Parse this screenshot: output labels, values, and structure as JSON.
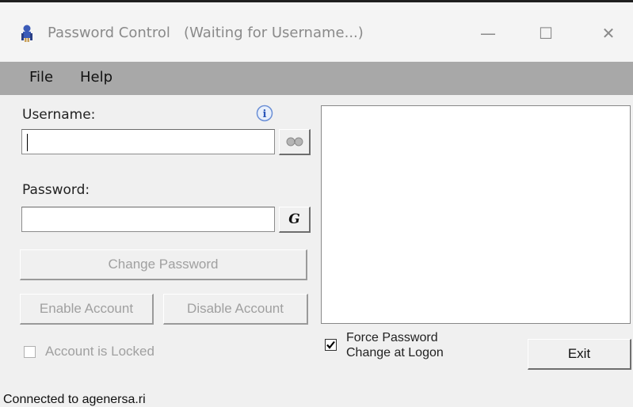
{
  "window": {
    "title": "Password Control",
    "title_status": "(Waiting for Username...)",
    "app_icon": "blue-agent-icon",
    "controls": {
      "minimize": "—",
      "maximize": "☐",
      "close": "✕"
    }
  },
  "menu": {
    "items": [
      {
        "label": "File"
      },
      {
        "label": "Help"
      }
    ]
  },
  "form": {
    "username_label": "Username:",
    "username_value": "",
    "info_icon": "i",
    "lookup_icon": "glasses-icon",
    "password_label": "Password:",
    "password_value": "",
    "generate_label": "G"
  },
  "buttons": {
    "change_password": "Change Password",
    "enable_account": "Enable Account",
    "disable_account": "Disable Account",
    "exit": "Exit"
  },
  "account_locked": {
    "label": "Account is Locked",
    "checked": false
  },
  "force_change": {
    "line1": "Force Password",
    "line2": "Change at Logon",
    "checked": true
  },
  "status": {
    "text": "Connected to agenersa.ri"
  },
  "colors": {
    "menubar": "#a8a8a8",
    "window_bg": "#f0f0f0",
    "disabled_text": "#a0a0a0"
  }
}
